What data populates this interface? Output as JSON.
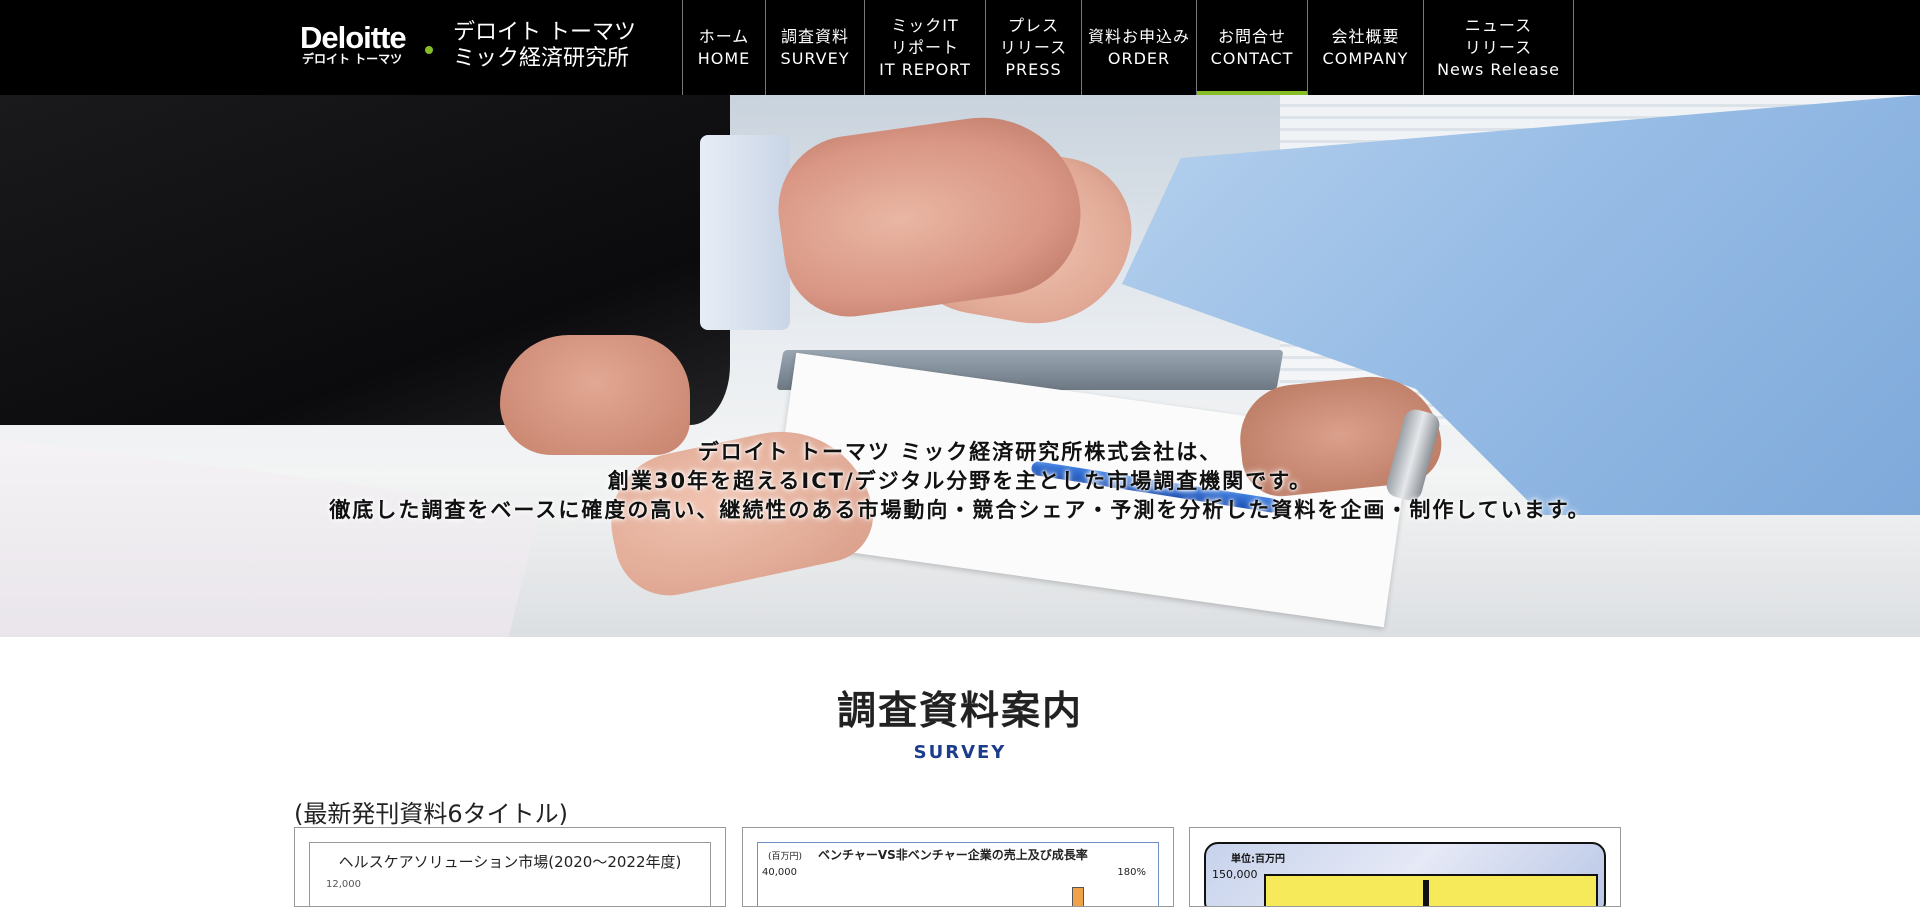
{
  "header": {
    "logo": {
      "wordmark": "Deloitte",
      "sub": "デロイト トーマツ"
    },
    "company_lines": [
      "デロイト トーマツ",
      "ミック経済研究所"
    ],
    "accent_color": "#86bc25"
  },
  "nav": [
    {
      "lines": [
        "ホーム",
        "HOME"
      ]
    },
    {
      "lines": [
        "調査資料",
        "SURVEY"
      ]
    },
    {
      "lines": [
        "ミックIT",
        "リポート",
        "IT REPORT"
      ]
    },
    {
      "lines": [
        "プレス",
        "リリース",
        "PRESS"
      ]
    },
    {
      "lines": [
        "資料お申込み",
        "ORDER"
      ]
    },
    {
      "lines": [
        "お問合せ",
        "CONTACT"
      ],
      "active": true
    },
    {
      "lines": [
        "会社概要",
        "COMPANY"
      ]
    },
    {
      "lines": [
        "ニュース",
        "リリース",
        "News Release"
      ]
    }
  ],
  "hero": {
    "lines": [
      "デロイト トーマツ ミック経済研究所株式会社は、",
      "創業30年を超えるICT/デジタル分野を主とした市場調査機関です。",
      "徹底した調査をベースに確度の高い、継続性のある市場動向・競合シェア・予測を分析した資料を企画・制作しています。"
    ]
  },
  "survey": {
    "title": "調査資料案内",
    "subtitle": "SURVEY",
    "subtitle_color": "#1c3c8c",
    "latest_label": "(最新発刊資料6タイトル)",
    "cards": [
      {
        "title": "ヘルスケアソリューション市場(2020〜2022年度)",
        "tick": "12,000"
      },
      {
        "title": "ベンチャーVS非ベンチャー企業の売上及び成長率",
        "unit": "(百万円)",
        "tick": "40,000",
        "pct": "180%"
      },
      {
        "unit": "単位:百万円",
        "tick": "150,000"
      }
    ]
  }
}
